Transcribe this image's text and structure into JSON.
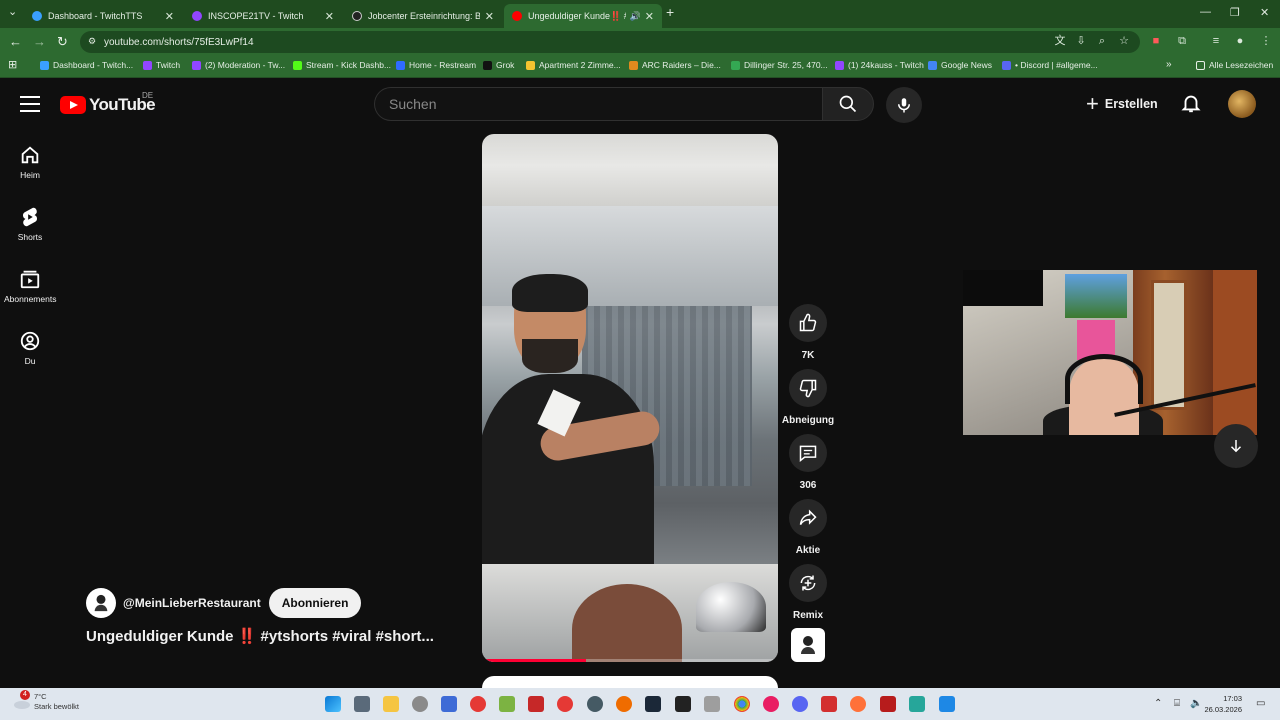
{
  "browser": {
    "tabs": [
      {
        "title": "Dashboard - TwitchTTS",
        "favicon_color": "#3aa0ff"
      },
      {
        "title": "INSCOPE21TV - Twitch",
        "favicon_color": "#9146ff"
      },
      {
        "title": "Jobcenter Ersteinrichtung: Betr",
        "favicon_color": "#222222"
      },
      {
        "title": "Ungeduldiger Kunde‼️ #yts",
        "favicon_color": "#ff0000"
      }
    ],
    "new_tab_label": "+",
    "url": "youtube.com/shorts/75fE3LwPf14",
    "bookmarks": [
      {
        "label": "Dashboard - Twitch...",
        "color": "#3aa0ff"
      },
      {
        "label": "Twitch",
        "color": "#9146ff"
      },
      {
        "label": "(2) Moderation - Tw...",
        "color": "#9146ff"
      },
      {
        "label": "Stream - Kick Dashb...",
        "color": "#53fc18"
      },
      {
        "label": "Home - Restream",
        "color": "#2f6bff"
      },
      {
        "label": "Grok",
        "color": "#111111"
      },
      {
        "label": "Apartment 2 Zimme...",
        "color": "#f4c430"
      },
      {
        "label": "ARC Raiders – Die...",
        "color": "#e08a1e"
      },
      {
        "label": "Dillinger Str. 25, 470...",
        "color": "#34a853"
      },
      {
        "label": "(1) 24kauss - Twitch",
        "color": "#9146ff"
      },
      {
        "label": "Google News",
        "color": "#4285f4"
      },
      {
        "label": "• Discord | #allgeme...",
        "color": "#5865f2"
      }
    ],
    "bookmarks_overflow": "»",
    "all_bookmarks_label": "Alle Lesezeichen"
  },
  "youtube": {
    "logo_text": "YouTube",
    "country_code": "DE",
    "search_placeholder": "Suchen",
    "create_label": "Erstellen",
    "sidebar": [
      {
        "label": "Heim",
        "icon": "home-icon"
      },
      {
        "label": "Shorts",
        "icon": "shorts-icon"
      },
      {
        "label": "Abonnements",
        "icon": "subscriptions-icon"
      },
      {
        "label": "Du",
        "icon": "user-icon"
      }
    ],
    "actions": {
      "like_count": "7K",
      "dislike_label": "Abneigung",
      "comment_count": "306",
      "share_label": "Aktie",
      "remix_label": "Remix"
    },
    "channel": {
      "handle": "@MeinLieberRestaurant",
      "subscribe_label": "Abonnieren"
    },
    "video": {
      "title_main": "Ungeduldiger Kunde",
      "title_emoji": "‼️",
      "hashtags": "#ytshorts  #viral  #short..."
    },
    "progress": 0.35
  },
  "taskbar": {
    "weather_temp": "7°C",
    "weather_desc": "Stark bewölkt",
    "notification_count": "4",
    "time": "17:03",
    "date": "26.03.2026"
  }
}
